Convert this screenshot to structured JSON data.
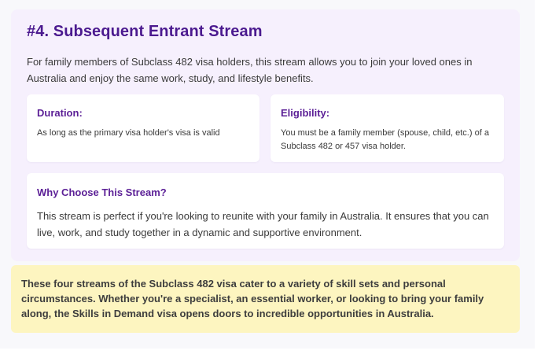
{
  "stream": {
    "title": "#4. Subsequent Entrant Stream",
    "description": "For family members of Subclass 482 visa holders, this stream allows you to join your loved ones in Australia and enjoy the same work, study, and lifestyle benefits."
  },
  "duration": {
    "heading": "Duration:",
    "text": "As long as the primary visa holder's visa is valid"
  },
  "eligibility": {
    "heading": "Eligibility:",
    "text": "You must be a family member (spouse, child, etc.) of a Subclass 482 or 457 visa holder."
  },
  "why": {
    "heading": "Why Choose This Stream?",
    "text": "This stream is perfect if you're looking to reunite with your family in Australia. It ensures that you can live, work, and study together in a dynamic and supportive environment."
  },
  "summary": {
    "text": "These four streams of the Subclass 482 visa cater to a variety of skill sets and personal circumstances. Whether you're a specialist, an essential worker, or looking to bring your family along, the Skills in Demand visa opens doors to incredible opportunities in Australia."
  },
  "colors": {
    "heading_purple": "#4b1a8f",
    "card_bg": "#f6f0fd",
    "summary_bg": "#fdf5c0"
  }
}
